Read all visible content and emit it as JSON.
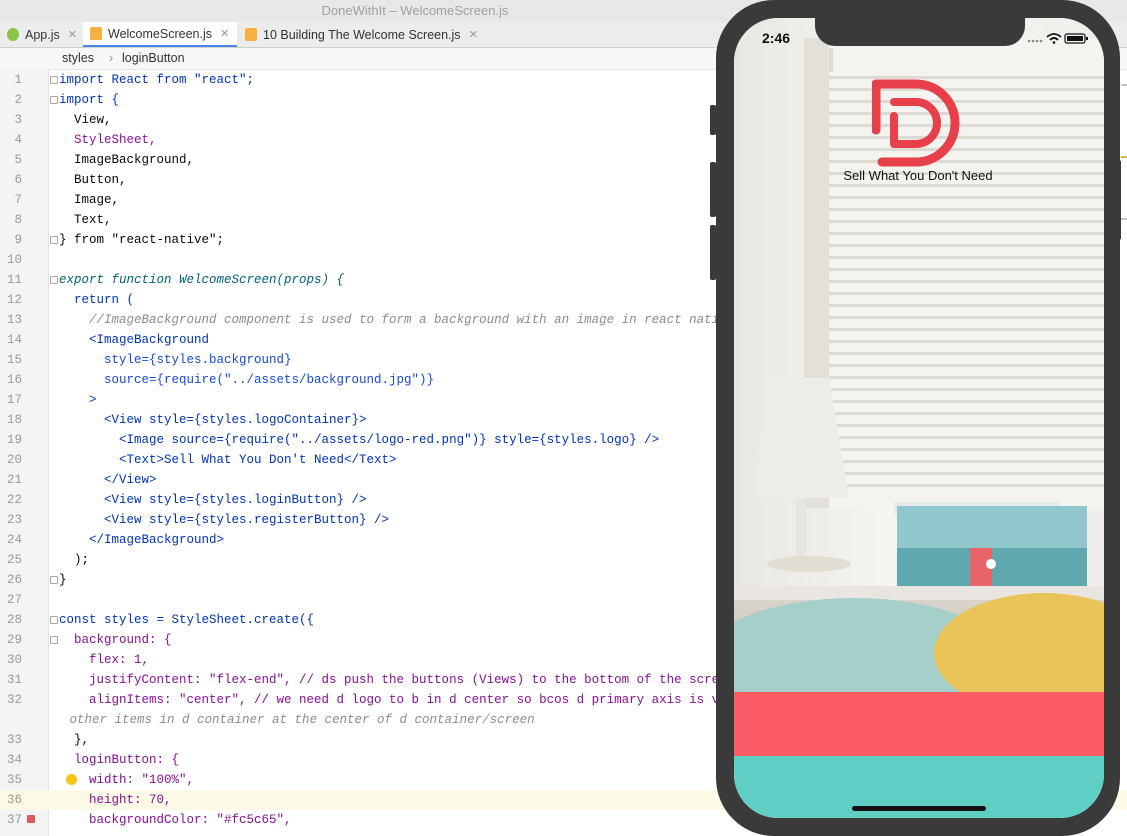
{
  "window": {
    "title": "DoneWithIt – WelcomeScreen.js"
  },
  "tabs": [
    {
      "label": "App.js",
      "color": "#8bc34a"
    },
    {
      "label": "WelcomeScreen.js",
      "color": "#f5b041",
      "active": true
    },
    {
      "label": "10 Building The Welcome Screen.js",
      "color": "#f5b041"
    }
  ],
  "breadcrumb": [
    "styles",
    "loginButton"
  ],
  "lines": [
    {
      "n": "1",
      "t": "import React from \"react\";"
    },
    {
      "n": "2",
      "t": "import {"
    },
    {
      "n": "3",
      "t": "  View,"
    },
    {
      "n": "4",
      "t": "  StyleSheet,"
    },
    {
      "n": "5",
      "t": "  ImageBackground,"
    },
    {
      "n": "6",
      "t": "  Button,"
    },
    {
      "n": "7",
      "t": "  Image,"
    },
    {
      "n": "8",
      "t": "  Text,"
    },
    {
      "n": "9",
      "t": "} from \"react-native\";"
    },
    {
      "n": "10",
      "t": ""
    },
    {
      "n": "11",
      "t": "export function WelcomeScreen(props) {"
    },
    {
      "n": "12",
      "t": "  return ("
    },
    {
      "n": "13",
      "t": "    //ImageBackground component is used to form a background with an image in react native"
    },
    {
      "n": "14",
      "t": "    <ImageBackground"
    },
    {
      "n": "15",
      "t": "      style={styles.background}"
    },
    {
      "n": "16",
      "t": "      source={require(\"../assets/background.jpg\")}"
    },
    {
      "n": "17",
      "t": "    >"
    },
    {
      "n": "18",
      "t": "      <View style={styles.logoContainer}>"
    },
    {
      "n": "19",
      "t": "        <Image source={require(\"../assets/logo-red.png\")} style={styles.logo} />"
    },
    {
      "n": "20",
      "t": "        <Text>Sell What You Don't Need</Text>"
    },
    {
      "n": "21",
      "t": "      </View>"
    },
    {
      "n": "22",
      "t": "      <View style={styles.loginButton} />"
    },
    {
      "n": "23",
      "t": "      <View style={styles.registerButton} />"
    },
    {
      "n": "24",
      "t": "    </ImageBackground>"
    },
    {
      "n": "25",
      "t": "  );"
    },
    {
      "n": "26",
      "t": "}"
    },
    {
      "n": "27",
      "t": ""
    },
    {
      "n": "28",
      "t": "const styles = StyleSheet.create({"
    },
    {
      "n": "29",
      "t": "  background: {"
    },
    {
      "n": "30",
      "t": "    flex: 1,"
    },
    {
      "n": "31",
      "t": "    justifyContent: \"flex-end\", // ds push the buttons (Views) to the bottom of the screen (re"
    },
    {
      "n": "32",
      "t": "    alignItems: \"center\", // we need d logo to b in d center so bcos d primary axis is vertica"
    },
    {
      "n": "",
      "t": " other items in d container at the center of d container/screen"
    },
    {
      "n": "33",
      "t": "  },"
    },
    {
      "n": "34",
      "t": "  loginButton: {"
    },
    {
      "n": "35",
      "t": "    width: \"100%\","
    },
    {
      "n": "36",
      "t": "    height: 70,"
    },
    {
      "n": "37",
      "t": "    backgroundColor: \"#fc5c65\","
    }
  ],
  "phone": {
    "time": "2:46",
    "tagline": "Sell What You Don't Need",
    "login_color": "#fc5c65",
    "register_color": "#5fcfc4",
    "logo_color": "#e8404a"
  }
}
